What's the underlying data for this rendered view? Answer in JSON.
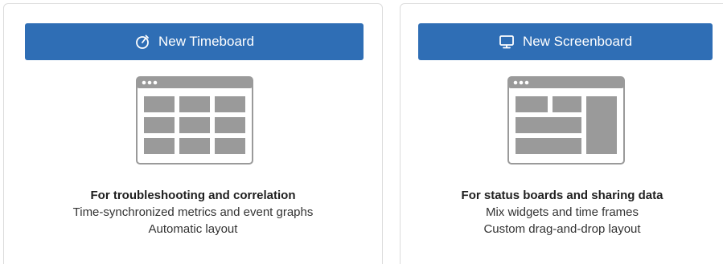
{
  "timeboard": {
    "button_label": "New Timeboard",
    "button_icon": "stopwatch-icon",
    "headline": "For troubleshooting and correlation",
    "line1": "Time-synchronized metrics and event graphs",
    "line2": "Automatic layout"
  },
  "screenboard": {
    "button_label": "New Screenboard",
    "button_icon": "monitor-icon",
    "headline": "For status boards and sharing data",
    "line1": "Mix widgets and time frames",
    "line2": "Custom drag-and-drop layout"
  },
  "colors": {
    "button_bg": "#2f6eb5",
    "illustration_gray": "#9a9a9a",
    "card_border": "#dcdcdc"
  }
}
